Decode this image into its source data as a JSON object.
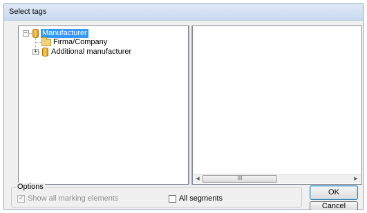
{
  "window": {
    "title": "Select tags"
  },
  "tree": {
    "root": {
      "label": "Manufacturer",
      "expander": "−",
      "selected": true
    },
    "children": [
      {
        "label": "Firma/Company",
        "icon": "folder-icon"
      },
      {
        "label": "Additional manufacturer",
        "icon": "database-icon",
        "expander": "+"
      }
    ]
  },
  "scrollbar": {
    "left_arrow": "◀",
    "right_arrow": "▶",
    "grip": "III"
  },
  "options": {
    "legend": "Options",
    "show_all_marking": {
      "label": "Show all marking elements",
      "checked": true,
      "disabled": true,
      "mark": "✓"
    },
    "all_segments": {
      "label": "All segments",
      "checked": false
    }
  },
  "buttons": {
    "ok": "OK",
    "cancel": "Cancel"
  }
}
